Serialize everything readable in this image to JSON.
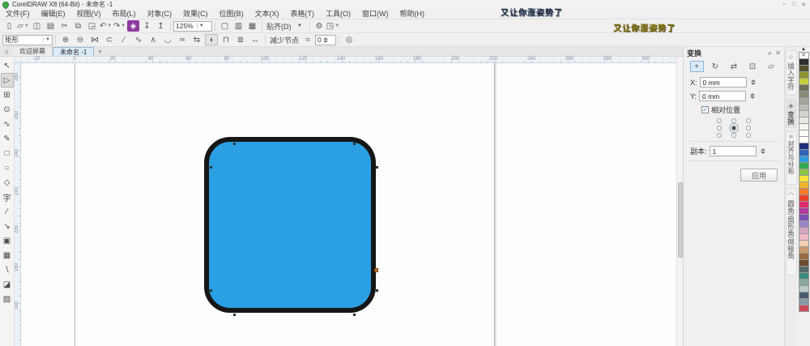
{
  "window": {
    "title": "CorelDRAW X8 (64-Bit) - 未命名 -1",
    "minimize": "─",
    "maximize": "□",
    "close": "✕"
  },
  "watermarks": {
    "title_bar": "又让你涨姿势了",
    "toolbar": "又让你涨姿势了"
  },
  "menu": {
    "items": [
      {
        "id": "file",
        "label": "文件(F)"
      },
      {
        "id": "edit",
        "label": "编辑(E)"
      },
      {
        "id": "view",
        "label": "视图(V)"
      },
      {
        "id": "layout",
        "label": "布局(L)"
      },
      {
        "id": "object",
        "label": "对象(C)"
      },
      {
        "id": "effects",
        "label": "效果(C)"
      },
      {
        "id": "bitmaps",
        "label": "位图(B)"
      },
      {
        "id": "text",
        "label": "文本(X)"
      },
      {
        "id": "table",
        "label": "表格(T)"
      },
      {
        "id": "tools",
        "label": "工具(O)"
      },
      {
        "id": "window",
        "label": "窗口(W)"
      },
      {
        "id": "help",
        "label": "帮助(H)"
      }
    ]
  },
  "toolbar": {
    "buttons": [
      {
        "name": "new-document",
        "glyph": "▯"
      },
      {
        "name": "open",
        "glyph": "▱",
        "dropdown": true
      },
      {
        "name": "save",
        "glyph": "◫"
      },
      {
        "name": "print",
        "glyph": "▤"
      },
      {
        "name": "cut",
        "glyph": "✂"
      },
      {
        "name": "copy",
        "glyph": "⧉"
      },
      {
        "name": "paste",
        "glyph": "◲"
      },
      {
        "name": "undo",
        "glyph": "↶",
        "dropdown": true
      },
      {
        "name": "redo",
        "glyph": "↷",
        "dropdown": true
      },
      {
        "name": "search-content",
        "glyph": "◈",
        "accent": "#8e3a9e"
      },
      {
        "name": "import",
        "glyph": "↧"
      },
      {
        "name": "export",
        "glyph": "↥"
      }
    ],
    "zoom_level": "125%",
    "view_buttons": [
      {
        "name": "full-screen-preview",
        "glyph": "▢"
      },
      {
        "name": "show-rulers",
        "glyph": "▥"
      },
      {
        "name": "show-grid",
        "glyph": "▦"
      }
    ],
    "snap_label": "贴齐(D)",
    "options_glyph": "⚙",
    "launcher_glyph": "◳"
  },
  "property_bar": {
    "preset_value": "矩形",
    "node_buttons": [
      {
        "name": "add-node",
        "glyph": "⊕"
      },
      {
        "name": "delete-node",
        "glyph": "⊖"
      },
      {
        "name": "join-nodes",
        "glyph": "⋈"
      },
      {
        "name": "break-curve",
        "glyph": "⊂"
      },
      {
        "name": "convert-to-line",
        "glyph": "∕"
      },
      {
        "name": "convert-to-curve",
        "glyph": "∿"
      },
      {
        "name": "cusp-node",
        "glyph": "∧"
      },
      {
        "name": "smooth-node",
        "glyph": "◡"
      },
      {
        "name": "symmetrical-node",
        "glyph": "≃"
      },
      {
        "name": "reverse-direction",
        "glyph": "⇆"
      },
      {
        "name": "close-curve",
        "glyph": "◗",
        "active": true
      },
      {
        "name": "extract-subpath",
        "glyph": "⊓"
      },
      {
        "name": "align-nodes",
        "glyph": "≣"
      },
      {
        "name": "reflect-nodes-horizontally",
        "glyph": "↔"
      }
    ],
    "reduce_nodes_label": "减少节点",
    "smoothness_glyph": "≈",
    "smoothness_value": "0",
    "box_selection_glyph": "◎"
  },
  "document_tabs": {
    "home_glyph": "⌂",
    "tabs": [
      {
        "id": "welcome-screen",
        "label": "欢迎屏幕",
        "active": false
      },
      {
        "id": "untitled-1",
        "label": "未命名 -1",
        "active": true
      }
    ],
    "new_tab_glyph": "+"
  },
  "toolbox": {
    "tools": [
      {
        "name": "pick-tool",
        "glyph": "↖"
      },
      {
        "name": "shape-tool",
        "glyph": "▷",
        "active": true
      },
      {
        "name": "crop-tool",
        "glyph": "⊞"
      },
      {
        "name": "zoom-tool",
        "glyph": "⊙"
      },
      {
        "name": "freehand-tool",
        "glyph": "∿"
      },
      {
        "name": "artistic-media-tool",
        "glyph": "✎"
      },
      {
        "name": "rectangle-tool",
        "glyph": "□"
      },
      {
        "name": "ellipse-tool",
        "glyph": "○"
      },
      {
        "name": "polygon-tool",
        "glyph": "◇"
      },
      {
        "name": "text-tool",
        "glyph": "字"
      },
      {
        "name": "parallel-dimension-tool",
        "glyph": "∕"
      },
      {
        "name": "connector-tool",
        "glyph": "↘"
      },
      {
        "name": "drop-shadow-tool",
        "glyph": "▣"
      },
      {
        "name": "transparency-tool",
        "glyph": "▦"
      },
      {
        "name": "color-eyedropper-tool",
        "glyph": "∖"
      },
      {
        "name": "interactive-fill-tool",
        "glyph": "◪"
      },
      {
        "name": "smart-fill-tool",
        "glyph": "▨"
      }
    ]
  },
  "rulers": {
    "h_labels": [
      "-20",
      "0",
      "20",
      "40",
      "60",
      "80",
      "100",
      "120",
      "140",
      "160",
      "180",
      "200",
      "220",
      "240",
      "260",
      "280",
      "300"
    ],
    "v_labels": [
      "280",
      "260",
      "240",
      "220",
      "200",
      "180",
      "160"
    ]
  },
  "canvas": {
    "shape": {
      "type": "rounded-rectangle",
      "fill": "#2b9fe3",
      "outline": "#161616",
      "selected_node_color": "#c77832"
    }
  },
  "docker": {
    "title": "变换",
    "collapse_glyph": "»",
    "close_glyph": "✕",
    "modes": [
      {
        "name": "position",
        "glyph": "+",
        "active": true
      },
      {
        "name": "rotate",
        "glyph": "↻"
      },
      {
        "name": "scale-mirror",
        "glyph": "⇄"
      },
      {
        "name": "size",
        "glyph": "⊡"
      },
      {
        "name": "skew",
        "glyph": "▱"
      }
    ],
    "x_label": "X:",
    "x_value": "0 mm",
    "y_label": "Y:",
    "y_value": "0 mm",
    "relative_label": "相对位置",
    "relative_checked": "✓",
    "copies_label": "副本:",
    "copies_value": "1",
    "apply_label": "应用"
  },
  "docker_tabs": {
    "tabs": [
      {
        "name": "insert-character",
        "icon": "☆",
        "label": "插入字符"
      },
      {
        "name": "transform",
        "icon": "◈",
        "label": "变换",
        "active": true
      },
      {
        "name": "align-distribute",
        "icon": "≡",
        "label": "对齐与分布"
      },
      {
        "name": "corners",
        "icon": "◠",
        "label": "圆角/扇形角/倒棱角"
      }
    ]
  },
  "palette": {
    "scroll_up_glyph": "▲",
    "no_color_glyph": "✕",
    "colors": [
      "#2e2e2e",
      "#52522e",
      "#8f9433",
      "#c3cf3d",
      "#6e6e5a",
      "#8a8a7a",
      "#a5a59a",
      "#bdbdb5",
      "#d5d5cf",
      "#e8e8e4",
      "#f5f5ef",
      "#fbfbf5",
      "#ffffff",
      "#1c2f7c",
      "#2f63b8",
      "#2f9bdf",
      "#34a853",
      "#8bc34a",
      "#f4e53a",
      "#f2b32e",
      "#ef7d2a",
      "#e8432e",
      "#e02a6e",
      "#b03a9e",
      "#7a4fb0",
      "#9a86c8",
      "#d4a5c0",
      "#f0b8c8",
      "#f5cdb0",
      "#c89a6a",
      "#9a6b42",
      "#6b4a2e",
      "#5a6b6b",
      "#3a8a7a",
      "#88a8a0",
      "#b8c8c4",
      "#4a5a6e",
      "#8898a8",
      "#c84a5a"
    ]
  }
}
